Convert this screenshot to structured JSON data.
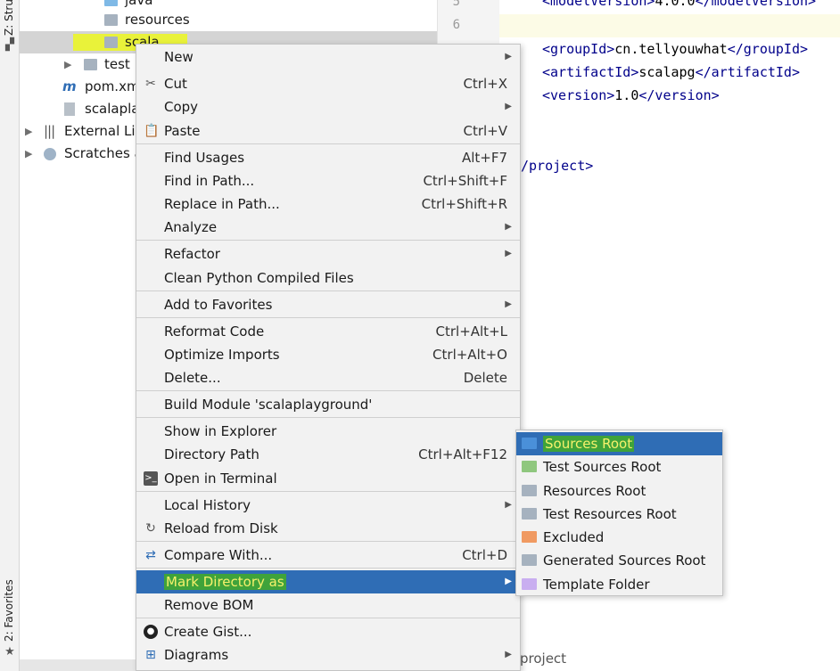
{
  "sidebar": {
    "structure_label": "Z: Stru",
    "favorites_label": "2: Favorites"
  },
  "tree": {
    "items": [
      {
        "label": "java"
      },
      {
        "label": "resources"
      },
      {
        "label": "scala"
      },
      {
        "label": "test"
      },
      {
        "label": "pom.xml"
      },
      {
        "label": "scalaplay"
      },
      {
        "label": "External Lib"
      },
      {
        "label": "Scratches a"
      }
    ]
  },
  "editor": {
    "line_numbers": [
      "5",
      "6"
    ],
    "lines": [
      {
        "open": "<modelVersion>",
        "text": "4.0.0",
        "close": "</modelVersion>"
      },
      {
        "open": "<groupId>",
        "text": "cn.tellyouwhat",
        "close": "</groupId>"
      },
      {
        "open": "<artifactId>",
        "text": "scalapg",
        "close": "</artifactId>"
      },
      {
        "open": "<version>",
        "text": "1.0",
        "close": "</version>"
      }
    ],
    "closing_tag": "/project>",
    "breadcrumb": "project"
  },
  "context_menu": {
    "items": [
      {
        "label": "New",
        "shortcut": "",
        "submenu": true
      },
      {
        "label": "Cut",
        "shortcut": "Ctrl+X",
        "icon": "scissors-icon"
      },
      {
        "label": "Copy",
        "shortcut": "",
        "submenu": true
      },
      {
        "label": "Paste",
        "shortcut": "Ctrl+V",
        "icon": "clipboard-icon"
      },
      {
        "label": "Find Usages",
        "shortcut": "Alt+F7"
      },
      {
        "label": "Find in Path...",
        "shortcut": "Ctrl+Shift+F"
      },
      {
        "label": "Replace in Path...",
        "shortcut": "Ctrl+Shift+R"
      },
      {
        "label": "Analyze",
        "shortcut": "",
        "submenu": true
      },
      {
        "label": "Refactor",
        "shortcut": "",
        "submenu": true
      },
      {
        "label": "Clean Python Compiled Files",
        "shortcut": ""
      },
      {
        "label": "Add to Favorites",
        "shortcut": "",
        "submenu": true
      },
      {
        "label": "Reformat Code",
        "shortcut": "Ctrl+Alt+L"
      },
      {
        "label": "Optimize Imports",
        "shortcut": "Ctrl+Alt+O"
      },
      {
        "label": "Delete...",
        "shortcut": "Delete"
      },
      {
        "label": "Build Module 'scalaplayground'",
        "shortcut": ""
      },
      {
        "label": "Show in Explorer",
        "shortcut": ""
      },
      {
        "label": "Directory Path",
        "shortcut": "Ctrl+Alt+F12"
      },
      {
        "label": "Open in Terminal",
        "shortcut": "",
        "icon": "terminal-icon"
      },
      {
        "label": "Local History",
        "shortcut": "",
        "submenu": true
      },
      {
        "label": "Reload from Disk",
        "shortcut": "",
        "icon": "reload-icon"
      },
      {
        "label": "Compare With...",
        "shortcut": "Ctrl+D",
        "icon": "compare-icon"
      },
      {
        "label": "Mark Directory as",
        "shortcut": "",
        "submenu": true,
        "active": true
      },
      {
        "label": "Remove BOM",
        "shortcut": ""
      },
      {
        "label": "Create Gist...",
        "shortcut": "",
        "icon": "github-icon"
      },
      {
        "label": "Diagrams",
        "shortcut": "",
        "submenu": true,
        "icon": "diagram-icon"
      }
    ]
  },
  "mark_submenu": {
    "items": [
      {
        "label": "Sources Root",
        "color": "#4a90d9",
        "active": true
      },
      {
        "label": "Test Sources Root",
        "color": "#8fc77e"
      },
      {
        "label": "Resources Root",
        "color": "#a6b2bf"
      },
      {
        "label": "Test Resources Root",
        "color": "#a6b2bf"
      },
      {
        "label": "Excluded",
        "color": "#f09a62"
      },
      {
        "label": "Generated Sources Root",
        "color": "#a6b2bf"
      },
      {
        "label": "Template Folder",
        "color": "#c9aef0"
      }
    ]
  },
  "colors": {
    "selection_blue": "#2f6db5",
    "highlight_yellow": "#e9f23a",
    "highlight_green": "#3fa33a",
    "xml_tag": "#00008a"
  }
}
